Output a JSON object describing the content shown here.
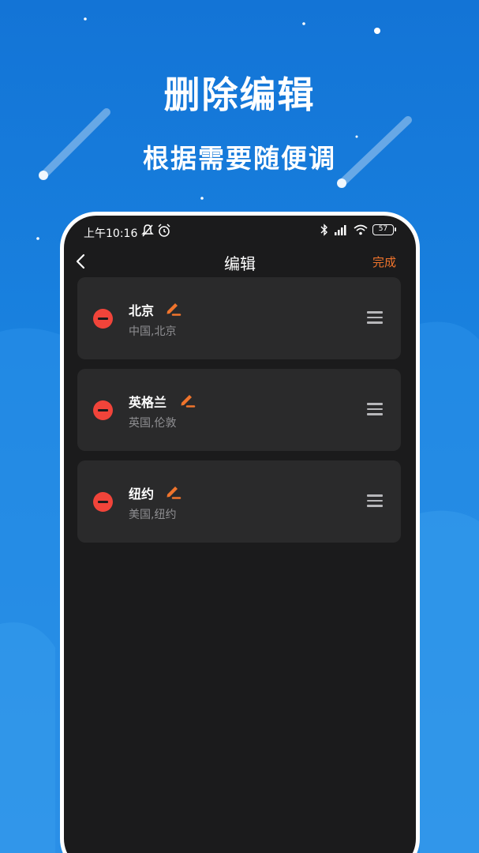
{
  "promo": {
    "title": "删除编辑",
    "subtitle": "根据需要随便调"
  },
  "status_bar": {
    "time": "上午10:16",
    "battery": "57",
    "icons": [
      "bell-muted-icon",
      "alarm-icon",
      "bluetooth-icon",
      "signal-icon",
      "wifi-icon",
      "battery-icon"
    ]
  },
  "header": {
    "title": "编辑",
    "done_label": "完成",
    "back_icon": "chevron-left-icon"
  },
  "cities": [
    {
      "name": "北京",
      "region": "中国,北京"
    },
    {
      "name": "英格兰",
      "region": "英国,伦敦"
    },
    {
      "name": "纽约",
      "region": "美国,纽约"
    }
  ],
  "colors": {
    "background": "#1374d6",
    "screen": "#1b1b1c",
    "card": "#2a2a2b",
    "accent": "#f0742c",
    "delete": "#f1443a"
  }
}
